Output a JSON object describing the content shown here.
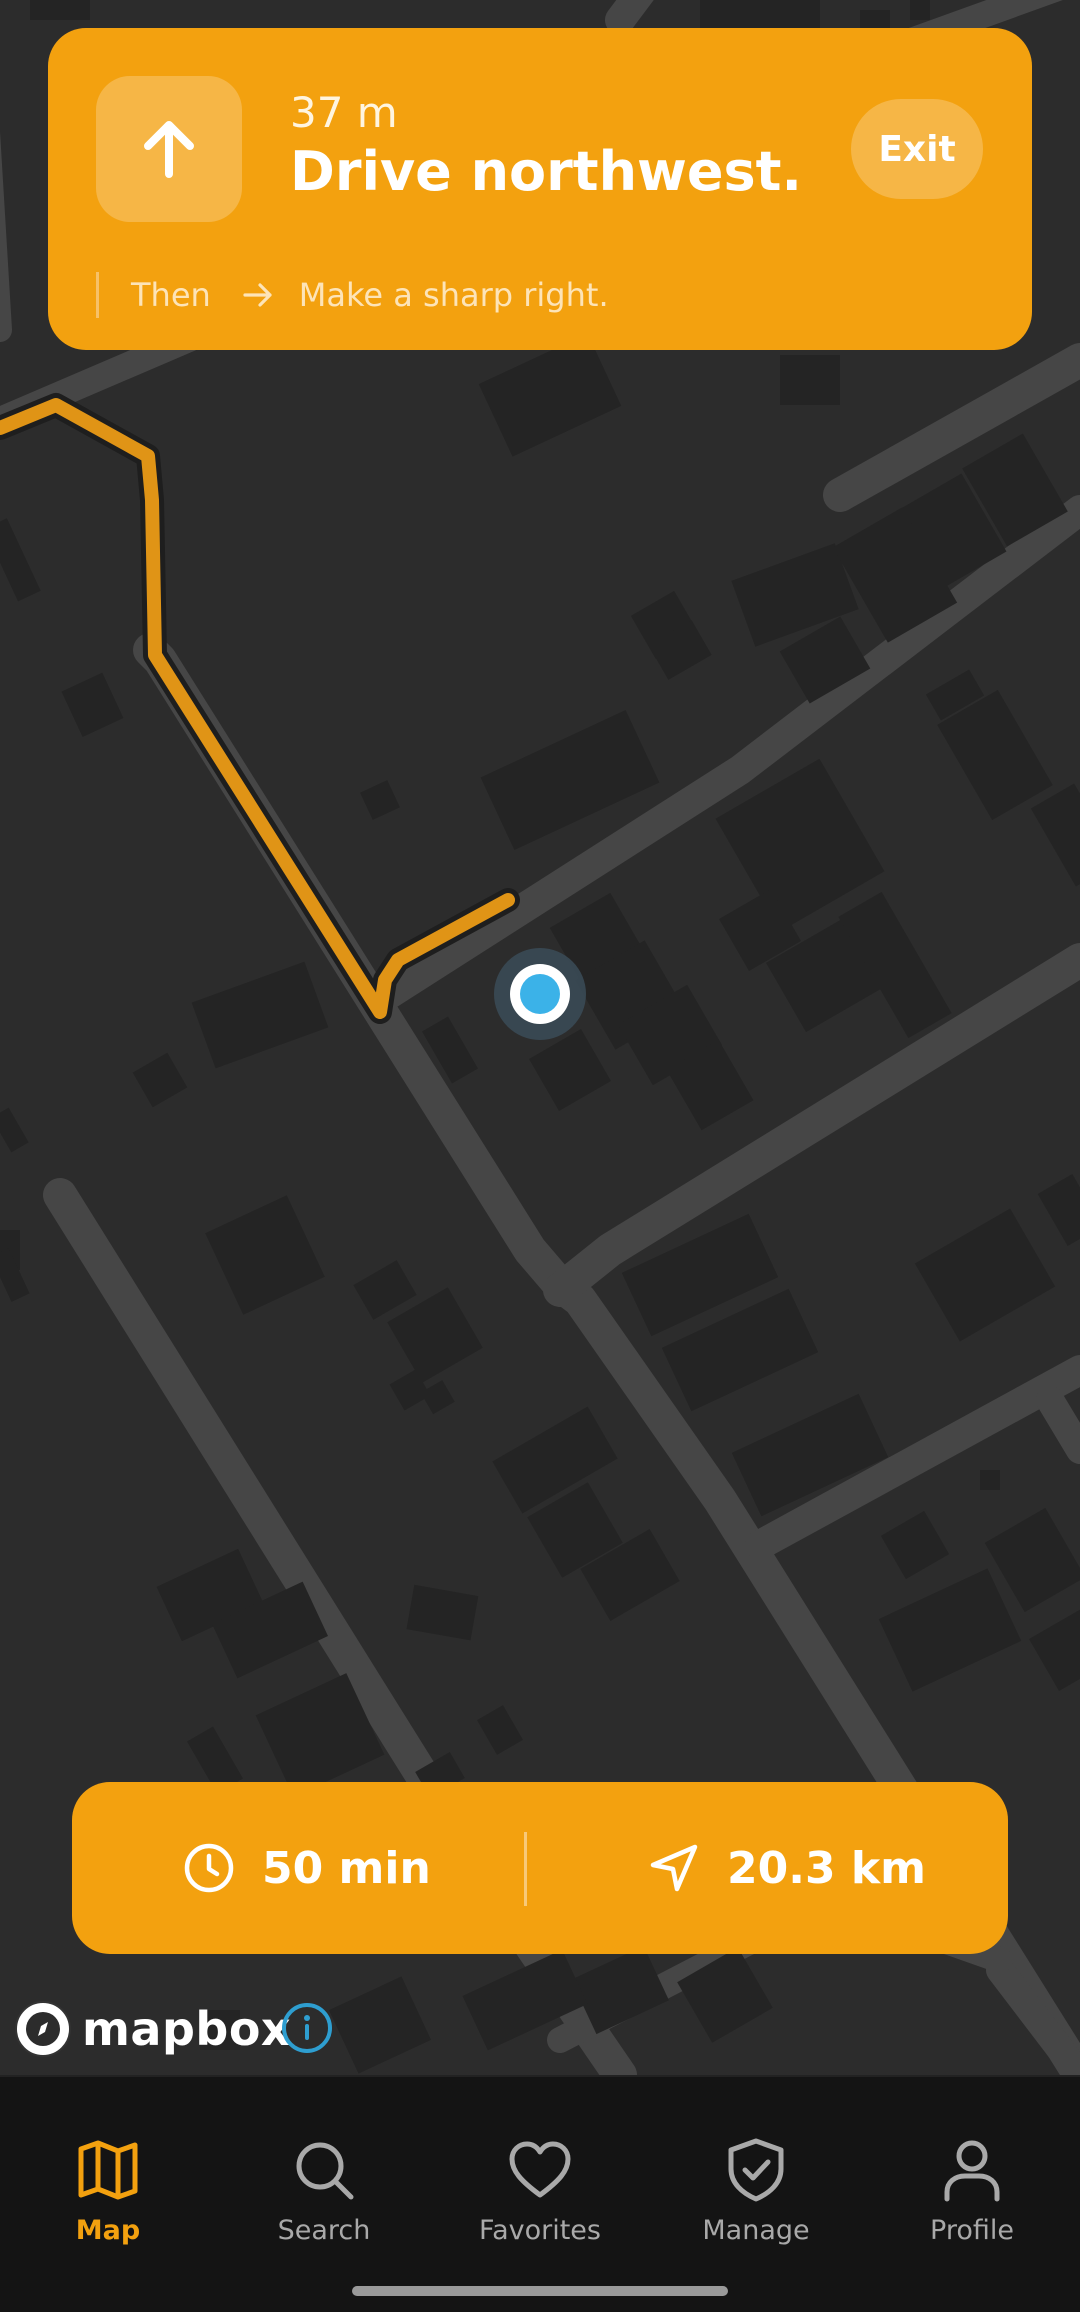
{
  "navigation": {
    "distance": "37 m",
    "instruction": "Drive northwest.",
    "exit_label": "Exit",
    "then_label": "Then",
    "next_instruction": "Make a sharp right."
  },
  "trip": {
    "duration": "50 min",
    "distance": "20.3 km"
  },
  "attribution": {
    "brand": "mapbox"
  },
  "bottom_nav": {
    "items": [
      {
        "label": "Map",
        "icon": "map-icon",
        "active": true
      },
      {
        "label": "Search",
        "icon": "search-icon",
        "active": false
      },
      {
        "label": "Favorites",
        "icon": "heart-icon",
        "active": false
      },
      {
        "label": "Manage",
        "icon": "shield-check-icon",
        "active": false
      },
      {
        "label": "Profile",
        "icon": "person-icon",
        "active": false
      }
    ]
  },
  "colors": {
    "accent": "#f3a10f",
    "route": "#e09416",
    "location": "#3bb2e8",
    "map_background": "#2c2c2c",
    "road": "#464646",
    "building": "#242424",
    "nav_background": "#141414"
  }
}
